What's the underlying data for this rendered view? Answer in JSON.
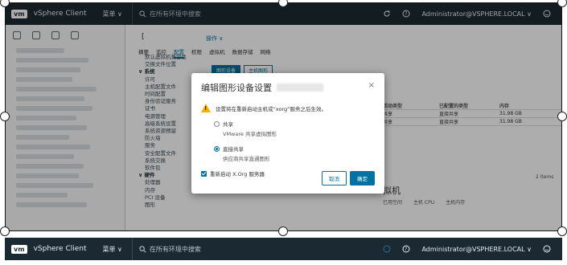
{
  "header": {
    "logo": "vm",
    "app_name": "vSphere Client",
    "menu_label": "菜单 ∨",
    "search_placeholder": "在所有环境中搜索",
    "user": "Administrator@VSPHERE.LOCAL ∨"
  },
  "object": {
    "title": "[",
    "actions_label": "操作 ∨"
  },
  "tabs": [
    "摘要",
    "监控",
    "配置",
    "权限",
    "虚拟机",
    "数据存储",
    "网络"
  ],
  "active_tab": "配置",
  "nav": {
    "items": [
      {
        "label": "默认虚拟机兼容性",
        "type": "ind"
      },
      {
        "label": "交换文件位置",
        "type": "ind"
      },
      {
        "label": "∨ 系统",
        "type": "grp"
      },
      {
        "label": "许可",
        "type": "ind"
      },
      {
        "label": "主机配置文件",
        "type": "ind"
      },
      {
        "label": "时间配置",
        "type": "ind"
      },
      {
        "label": "身份验证服务",
        "type": "ind"
      },
      {
        "label": "证书",
        "type": "ind"
      },
      {
        "label": "电源管理",
        "type": "ind"
      },
      {
        "label": "高级系统设置",
        "type": "ind"
      },
      {
        "label": "系统资源预留",
        "type": "ind"
      },
      {
        "label": "防火墙",
        "type": "ind"
      },
      {
        "label": "服务",
        "type": "ind"
      },
      {
        "label": "安全配置文件",
        "type": "ind"
      },
      {
        "label": "系统交换",
        "type": "ind"
      },
      {
        "label": "软件包",
        "type": "ind"
      },
      {
        "label": "∨ 硬件",
        "type": "grp"
      },
      {
        "label": "处理器",
        "type": "ind"
      },
      {
        "label": "内存",
        "type": "ind"
      },
      {
        "label": "PCI 设备",
        "type": "ind"
      },
      {
        "label": "图形",
        "type": "ind"
      }
    ]
  },
  "sub_tabs": [
    "图形设备",
    "主机图形"
  ],
  "table": {
    "headers": [
      "活动类型",
      "已配置的类型",
      "内存"
    ],
    "rows": [
      [
        "共享",
        "直接共享",
        "31.98 GB"
      ],
      [
        "共享",
        "直接共享",
        "31.98 GB"
      ]
    ],
    "item_count": "2 items"
  },
  "vm_section": {
    "title": "拟机",
    "columns": [
      "已用空间",
      "主机 CPU",
      "主机内存"
    ]
  },
  "dialog": {
    "title": "编辑图形设备设置",
    "close": "×",
    "warning": "设置将在重新启动主机或“xorg”服务之后生效。",
    "option_shared": "共享",
    "option_shared_desc": "VMware 共享虚拟图形",
    "option_direct": "直接共享",
    "option_direct_desc": "供应商共享直通图形",
    "restart_label": "重新启动 X.Org 服务器",
    "cancel": "取消",
    "ok": "确定"
  },
  "header2": {
    "logo": "vm",
    "app_name": "vSphere Client",
    "menu_label": "菜单 ∨",
    "search_placeholder": "在所有环境中搜索",
    "user": "Administrator@VSPHERE.LOCAL ∨"
  }
}
